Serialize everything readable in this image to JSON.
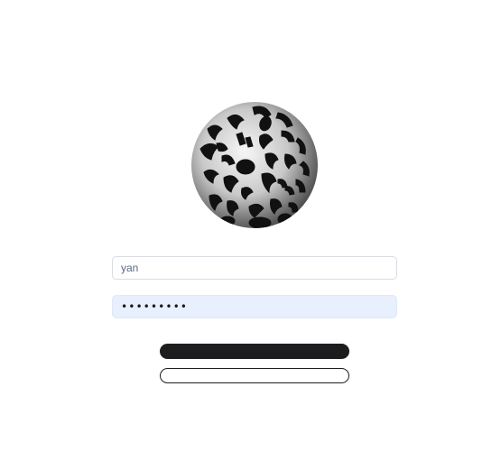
{
  "logo": {
    "icon": "leopard-print-sphere-icon",
    "colors": {
      "spot": "#111111",
      "light": "#f4f4f4",
      "dark": "#555555"
    }
  },
  "login_form": {
    "username": {
      "value": "yan",
      "placeholder": ""
    },
    "password": {
      "value": "•••••••••",
      "placeholder": ""
    },
    "primary_button": {
      "label": ""
    },
    "secondary_button": {
      "label": ""
    }
  },
  "colors": {
    "field_border": "#d9dce1",
    "password_fill": "#e8effd",
    "button_dark": "#1d1d1f"
  }
}
